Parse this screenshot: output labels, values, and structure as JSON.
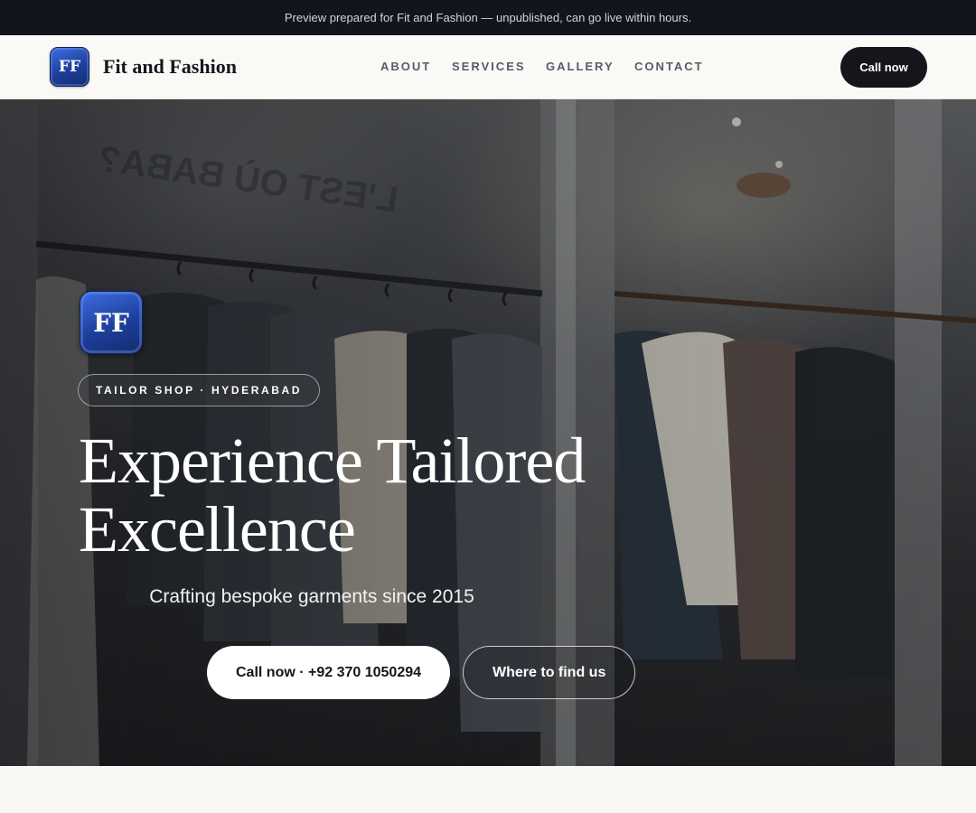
{
  "preview_banner": {
    "text": "Preview prepared for Fit and Fashion — unpublished, can go live within hours."
  },
  "header": {
    "logo_initials": "FF",
    "brand_name": "Fit and Fashion",
    "nav": [
      {
        "label": "ABOUT"
      },
      {
        "label": "SERVICES"
      },
      {
        "label": "GALLERY"
      },
      {
        "label": "CONTACT"
      }
    ],
    "cta_label": "Call now"
  },
  "hero": {
    "logo_initials": "FF",
    "tag": "TAILOR SHOP · HYDERABAD",
    "title_line1": "Experience Tailored",
    "title_line2": "Excellence",
    "subtitle": "Crafting bespoke garments since 2015",
    "primary_cta": "Call now · +92 370 1050294",
    "secondary_cta": "Where to find us",
    "background_image": "clothing-rack-store-window"
  },
  "colors": {
    "banner_bg": "#12151b",
    "header_bg": "#faf9f6",
    "dark_button": "#14161c",
    "logo_blue": "#1d3f9c",
    "page_bg": "#f9f8f5"
  }
}
